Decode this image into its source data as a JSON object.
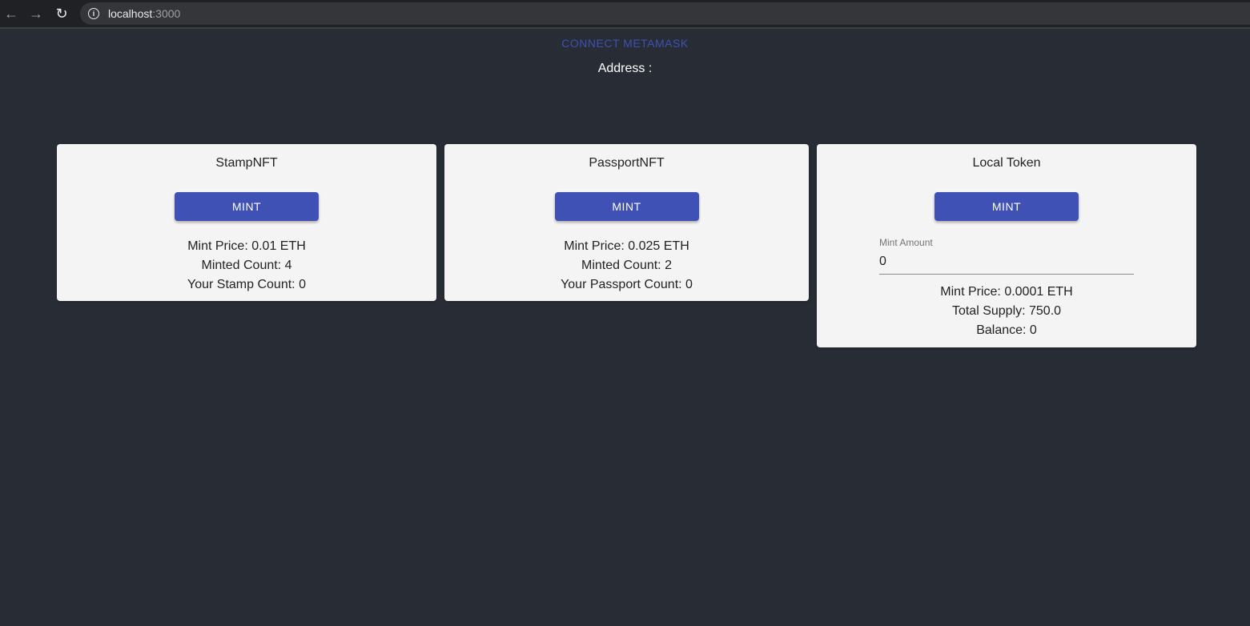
{
  "browser": {
    "url_host": "localhost",
    "url_port": ":3000"
  },
  "header": {
    "connect_label": "CONNECT METAMASK",
    "address_label": "Address :"
  },
  "cards": [
    {
      "title": "StampNFT",
      "button_label": "MINT",
      "lines": [
        "Mint Price: 0.01 ETH",
        "Minted Count: 4",
        "Your Stamp Count: 0"
      ]
    },
    {
      "title": "PassportNFT",
      "button_label": "MINT",
      "lines": [
        "Mint Price: 0.025 ETH",
        "Minted Count: 2",
        "Your Passport Count: 0"
      ]
    },
    {
      "title": "Local Token",
      "button_label": "MINT",
      "input_label": "Mint Amount",
      "input_value": "0",
      "lines": [
        "Mint Price: 0.0001 ETH",
        "Total Supply: 750.0",
        "Balance: 0"
      ]
    }
  ],
  "colors": {
    "background": "#282c34",
    "card": "#f4f4f4",
    "primary": "#3f51b5"
  },
  "icons": {
    "back": "arrow-left",
    "forward": "arrow-right",
    "reload": "reload",
    "info": "info-circle"
  }
}
